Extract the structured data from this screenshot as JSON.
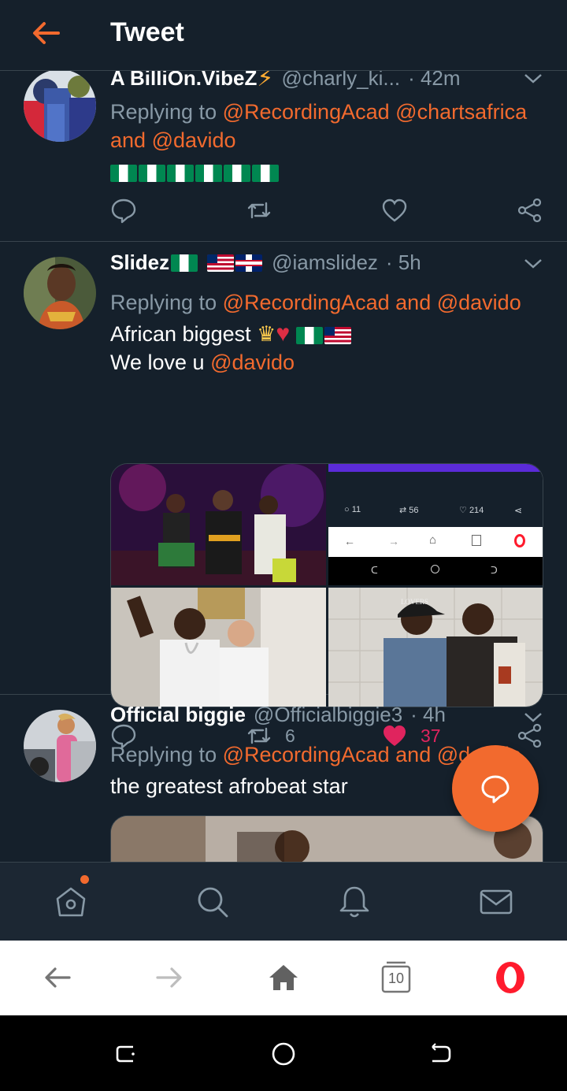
{
  "header": {
    "title": "Tweet"
  },
  "tweets": [
    {
      "name": "A BilliOn.VibeZ",
      "handle": "@charly_ki...",
      "time": "· 42m",
      "replying_prefix": "Replying to",
      "mention_1": "@RecordingAcad",
      "mention_2": "@chartsafrica",
      "and": "and",
      "mention_3": "@davido"
    },
    {
      "name": "Slidez",
      "handle": "@iamslidez",
      "time": "· 5h",
      "replying_prefix": "Replying to",
      "mention_1": "@RecordingAcad",
      "and": "and",
      "mention_2": "@davido",
      "line_1": "African biggest",
      "line_2": "We love u",
      "line_2_mention": "@davido",
      "retweets": "6",
      "likes": "37",
      "screenshot_counts": {
        "replies": "11",
        "retweets": "56",
        "likes": "214"
      },
      "cap_text": "LOVERS"
    },
    {
      "name": "Official biggie",
      "handle": "@Officialbiggie3",
      "time": "· 4h",
      "replying_prefix": "Replying to",
      "mention_1": "@RecordingAcad",
      "and": "and",
      "mention_2": "@davido",
      "line_1": "the greatest afrobeat star"
    }
  ],
  "browser": {
    "tab_count": "10"
  },
  "colors": {
    "accent": "#f26a2e",
    "background": "#15202b",
    "like": "#e0245e",
    "muted": "#8899a6"
  },
  "icons": [
    "back-arrow-icon",
    "chevron-down-icon",
    "reply-icon",
    "retweet-icon",
    "like-icon",
    "share-icon",
    "compose-icon",
    "home-icon",
    "search-icon",
    "bell-icon",
    "mail-icon",
    "browser-home-icon",
    "tabs-icon",
    "opera-icon"
  ]
}
